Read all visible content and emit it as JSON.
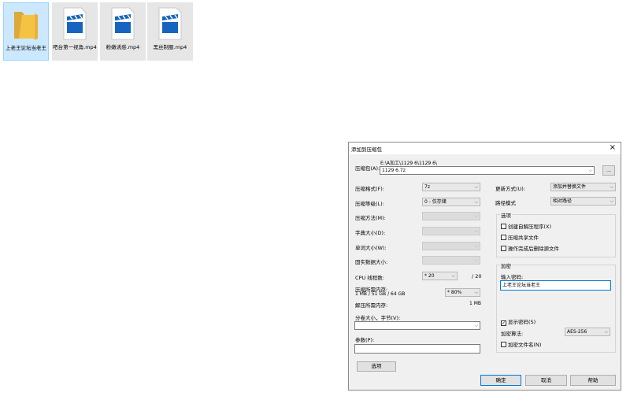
{
  "desktop": {
    "files": [
      {
        "name": "上老王论坛当老王",
        "type": "folder",
        "selected": true
      },
      {
        "name": "吧台第一视角.mp4",
        "type": "video",
        "selected": false
      },
      {
        "name": "粉嫩诱惑.mp4",
        "type": "video",
        "selected": false
      },
      {
        "name": "黑丝制服.mp4",
        "type": "video",
        "selected": false
      }
    ]
  },
  "dialog": {
    "title": "添加到压缩包",
    "close_glyph": "×",
    "archive_label": "压缩包(A):",
    "archive_path": "E:\\A加工\\1129 6\\1129 6\\",
    "archive_name": "1129 6.7z",
    "browse_label": "...",
    "left": {
      "format_label": "压缩格式(F):",
      "format_value": "7z",
      "level_label": "压缩等级(L):",
      "level_value": "0 - 仅存储",
      "method_label": "压缩方法(M):",
      "dict_label": "字典大小(D):",
      "word_label": "单词大小(W):",
      "solid_label": "固实数据大小:",
      "cpu_label": "CPU 线程数:",
      "cpu_value": "* 20",
      "cpu_total": "/ 20",
      "mem_compress_label": "压缩所需内存:",
      "mem_compress_detail": "1 MB / 51 GB / 64 GB",
      "mem_percent": "* 80%",
      "mem_decompress_label": "解压所需内存:",
      "mem_decompress_value": "1 MB",
      "split_label": "分卷大小，字节(V):",
      "params_label": "参数(P):",
      "options_button": "选项"
    },
    "right": {
      "update_label": "更新方式(U):",
      "update_value": "添加并替换文件",
      "path_label": "路径模式",
      "path_value": "相对路径",
      "options_group": "选项",
      "opt_sfx": "创建自解压程序(X)",
      "opt_shared": "压缩共享文件",
      "opt_delete": "操作完成后删除源文件",
      "encrypt_group": "加密",
      "password_label": "输入密码:",
      "password_value": "上老王论坛当老王",
      "show_password": "显示密码(S)",
      "algo_label": "加密算法:",
      "algo_value": "AES-256",
      "encrypt_names": "加密文件名(N)"
    },
    "buttons": {
      "ok": "确定",
      "cancel": "取消",
      "help": "帮助"
    }
  },
  "colors": {
    "selection": "#cce8ff",
    "accent": "#0078d7",
    "folder": "#f5c342",
    "video_icon": "#1565c0"
  }
}
